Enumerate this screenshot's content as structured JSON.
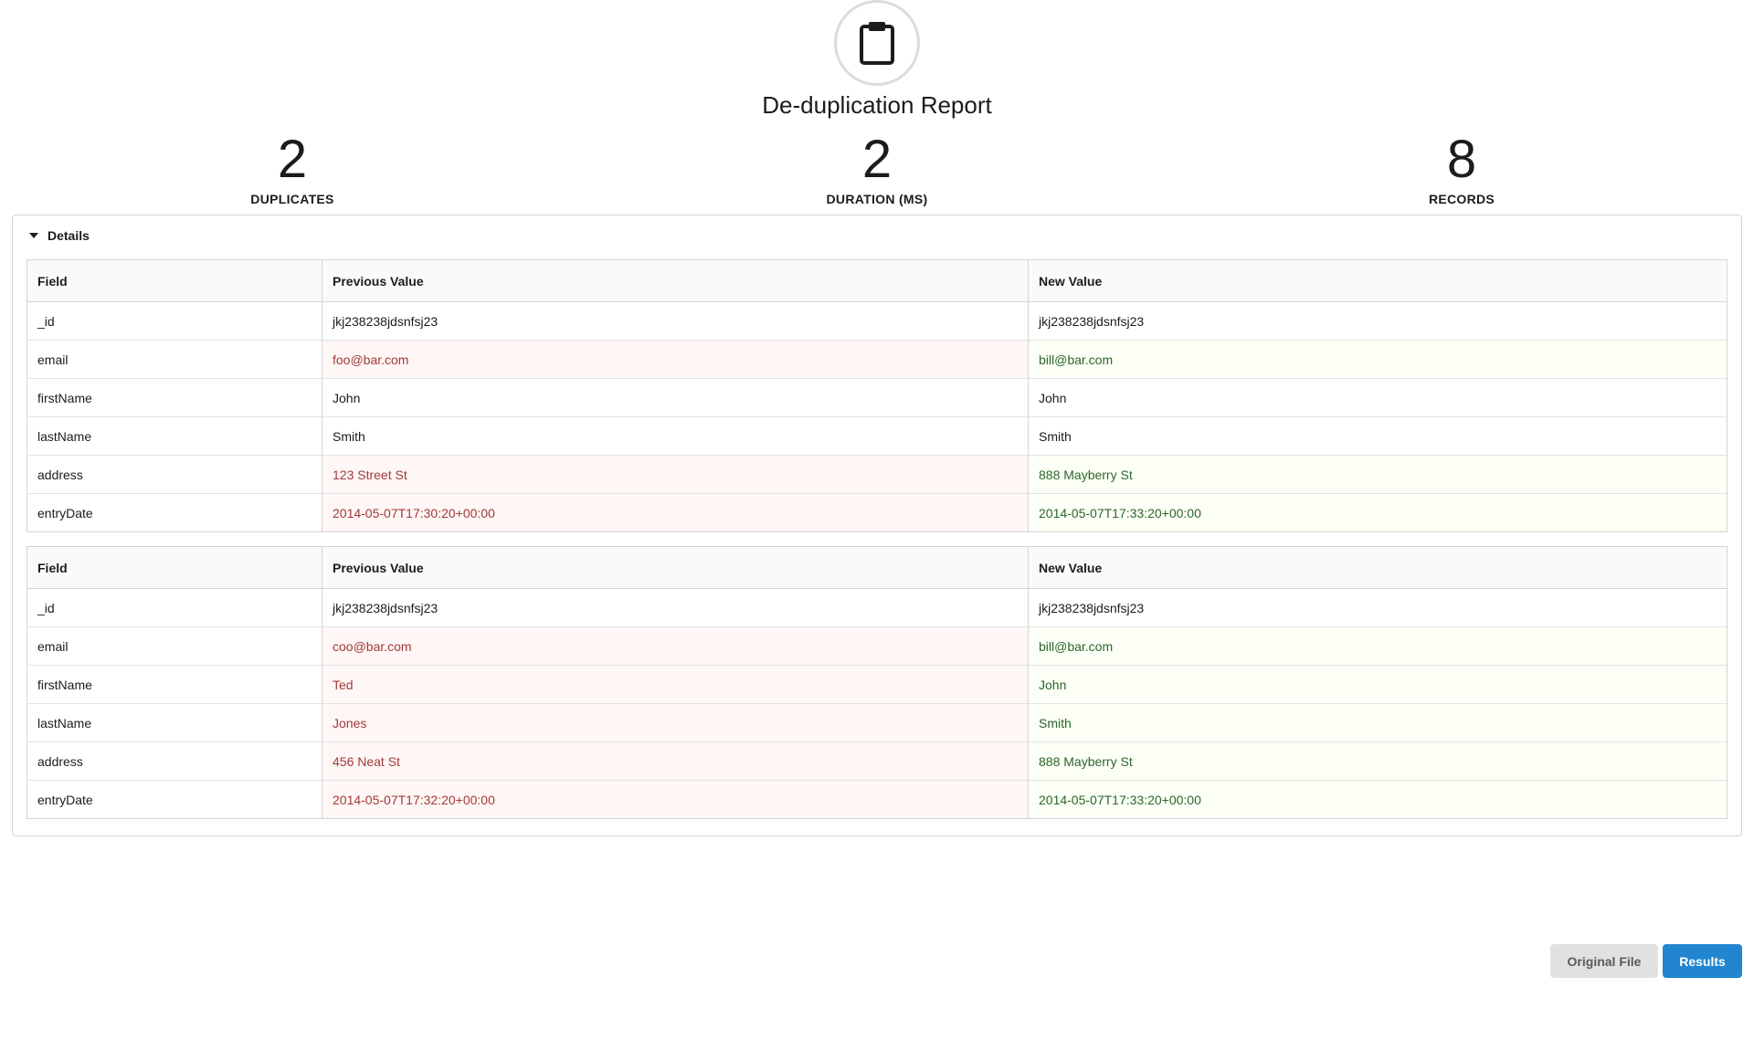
{
  "header": {
    "icon": "clipboard-icon",
    "title": "De-duplication Report"
  },
  "stats": [
    {
      "value": "2",
      "label": "DUPLICATES"
    },
    {
      "value": "2",
      "label": "DURATION (MS)"
    },
    {
      "value": "8",
      "label": "RECORDS"
    }
  ],
  "details": {
    "label": "Details",
    "columns": [
      "Field",
      "Previous Value",
      "New Value"
    ],
    "tables": [
      {
        "rows": [
          {
            "field": "_id",
            "prev": "jkj238238jdsnfsj23",
            "new": "jkj238238jdsnfsj23",
            "changed": false
          },
          {
            "field": "email",
            "prev": "foo@bar.com",
            "new": "bill@bar.com",
            "changed": true
          },
          {
            "field": "firstName",
            "prev": "John",
            "new": "John",
            "changed": false
          },
          {
            "field": "lastName",
            "prev": "Smith",
            "new": "Smith",
            "changed": false
          },
          {
            "field": "address",
            "prev": "123 Street St",
            "new": "888 Mayberry St",
            "changed": true
          },
          {
            "field": "entryDate",
            "prev": "2014-05-07T17:30:20+00:00",
            "new": "2014-05-07T17:33:20+00:00",
            "changed": true
          }
        ]
      },
      {
        "rows": [
          {
            "field": "_id",
            "prev": "jkj238238jdsnfsj23",
            "new": "jkj238238jdsnfsj23",
            "changed": false
          },
          {
            "field": "email",
            "prev": "coo@bar.com",
            "new": "bill@bar.com",
            "changed": true
          },
          {
            "field": "firstName",
            "prev": "Ted",
            "new": "John",
            "changed": true
          },
          {
            "field": "lastName",
            "prev": "Jones",
            "new": "Smith",
            "changed": true
          },
          {
            "field": "address",
            "prev": "456 Neat St",
            "new": "888 Mayberry St",
            "changed": true
          },
          {
            "field": "entryDate",
            "prev": "2014-05-07T17:32:20+00:00",
            "new": "2014-05-07T17:33:20+00:00",
            "changed": true
          }
        ]
      }
    ]
  },
  "buttons": {
    "original_file": "Original File",
    "results": "Results"
  },
  "colors": {
    "primary": "#2185d0",
    "negative_bg": "#fff6f6",
    "negative_text": "#9f3a38",
    "positive_bg": "#fcfff5",
    "positive_text": "#2c662d"
  }
}
